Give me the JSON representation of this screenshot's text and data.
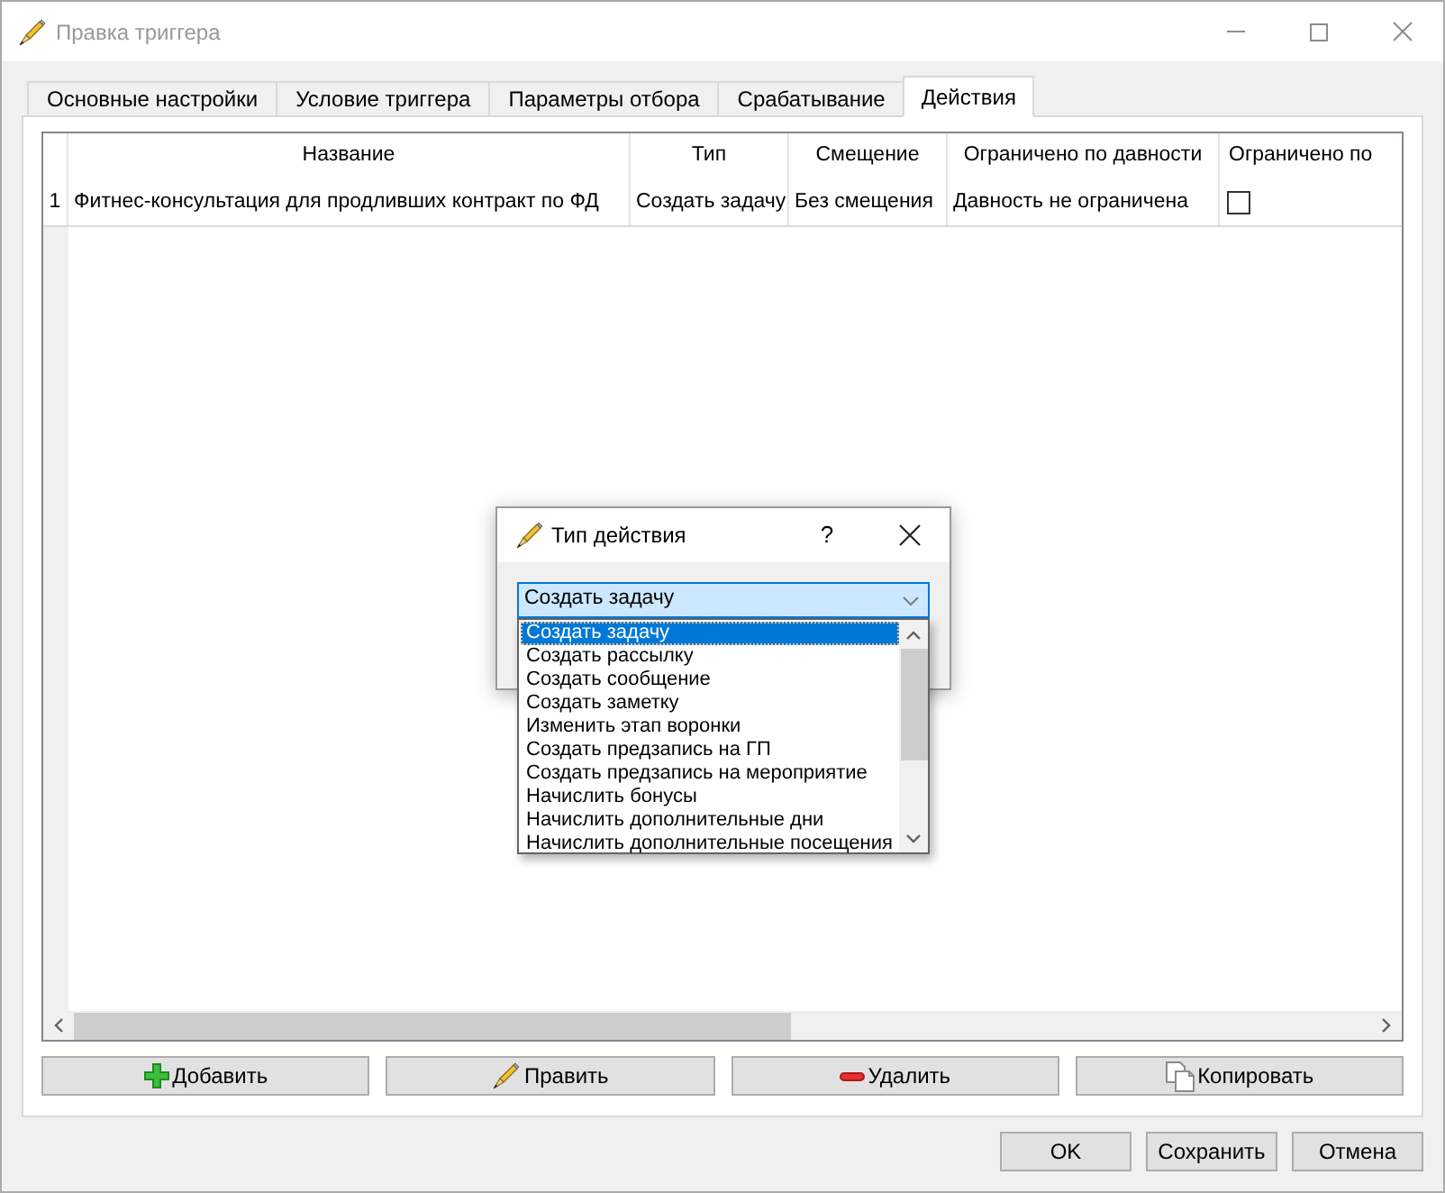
{
  "window": {
    "title": "Правка триггера"
  },
  "tabs": [
    {
      "label": "Основные настройки",
      "selected": false
    },
    {
      "label": "Условие триггера",
      "selected": false
    },
    {
      "label": "Параметры отбора",
      "selected": false
    },
    {
      "label": "Срабатывание",
      "selected": false
    },
    {
      "label": "Действия",
      "selected": true
    }
  ],
  "table": {
    "columns": [
      "Название",
      "Тип",
      "Смещение",
      "Ограничено по давности",
      "Ограничено по"
    ],
    "rows": [
      {
        "number": "1",
        "cells": [
          "Фитнес-консультация для продливших контракт по ФД",
          "Создать задачу",
          "Без смещения",
          "Давность не ограничена"
        ],
        "checked": false
      }
    ]
  },
  "action_buttons": [
    {
      "label": "Добавить",
      "kind": "add"
    },
    {
      "label": "Править",
      "kind": "edit"
    },
    {
      "label": "Удалить",
      "kind": "delete"
    },
    {
      "label": "Копировать",
      "kind": "copy"
    }
  ],
  "buttons": [
    "OK",
    "Сохранить",
    "Отмена"
  ],
  "dialog": {
    "title": "Тип действия",
    "help": "?",
    "combo": {
      "value": "Создать задачу",
      "expanded": true
    },
    "options": [
      {
        "label": "Создать задачу",
        "selected": true
      },
      {
        "label": "Создать рассылку",
        "selected": false
      },
      {
        "label": "Создать сообщение",
        "selected": false
      },
      {
        "label": "Создать заметку",
        "selected": false
      },
      {
        "label": "Изменить этап воронки",
        "selected": false
      },
      {
        "label": "Создать предзапись на ГП",
        "selected": false
      },
      {
        "label": "Создать предзапись на мероприятие",
        "selected": false
      },
      {
        "label": "Начислить бонусы",
        "selected": false
      },
      {
        "label": "Начислить дополнительные дни",
        "selected": false
      },
      {
        "label": "Начислить дополнительные посещения",
        "selected": false
      }
    ]
  }
}
